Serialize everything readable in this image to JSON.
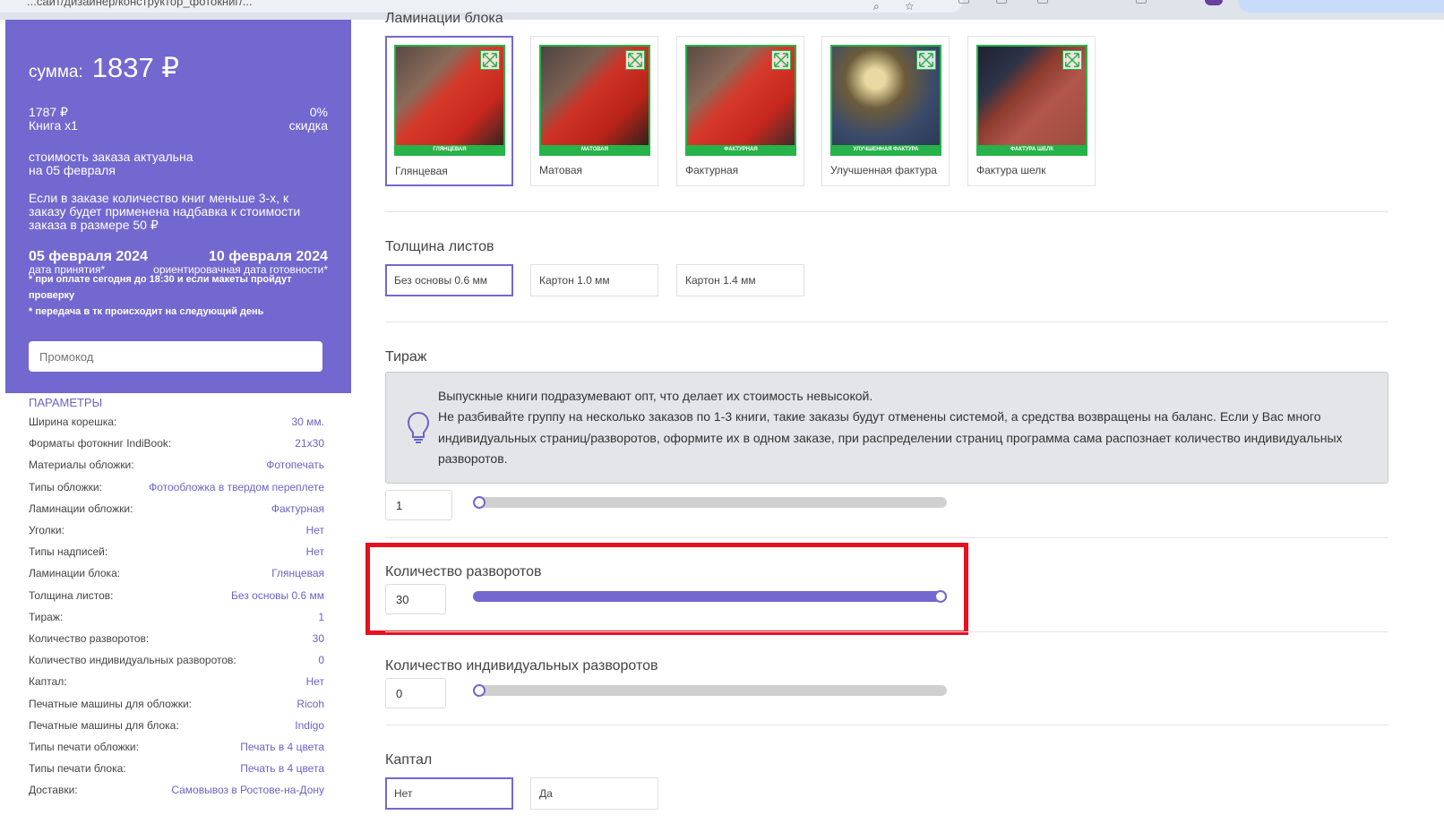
{
  "browser": {
    "url": "...сайт/дизайнер/конструктор_фотокниг/..."
  },
  "summary": {
    "sum_label": "сумма:",
    "sum_value": "1837 ₽",
    "price": "1787 ₽",
    "qty": "Книга x1",
    "discount_pct": "0%",
    "discount_label": "скидка",
    "actual_line1": "стоимость заказа актуальна",
    "actual_line2": "на 05 февраля",
    "notice": "Если в заказе количество книг меньше 3-х, к заказу будет применена надбавка к стоимости заказа в размере 50 ₽",
    "date_accept": "05 февраля 2024",
    "date_accept_label": "дата принятия*",
    "date_ready": "10 февраля 2024",
    "date_ready_label": "ориентировачная дата готовности*",
    "note1": "* при оплате сегодня до 18:30 и если макеты пройдут проверку",
    "note2": "* передача в тк происходит на следующий день",
    "promo_placeholder": "Промокод"
  },
  "params": {
    "title": "ПАРАМЕТРЫ",
    "rows": [
      {
        "k": "Ширина корешка:",
        "v": "30 мм."
      },
      {
        "k": "Форматы фотокниг IndiBook:",
        "v": "21x30"
      },
      {
        "k": "Материалы обложки:",
        "v": "Фотопечать"
      },
      {
        "k": "Типы обложки:",
        "v": "Фотообложка в твердом переплете"
      },
      {
        "k": "Ламинации обложки:",
        "v": "Фактурная"
      },
      {
        "k": "Уголки:",
        "v": "Нет"
      },
      {
        "k": "Типы надписей:",
        "v": "Нет"
      },
      {
        "k": "Ламинации блока:",
        "v": "Глянцевая"
      },
      {
        "k": "Толщина листов:",
        "v": "Без основы 0.6 мм"
      },
      {
        "k": "Тираж:",
        "v": "1"
      },
      {
        "k": "Количество разворотов:",
        "v": "30"
      },
      {
        "k": "Количество индивидуальных разворотов:",
        "v": "0"
      },
      {
        "k": "Каптал:",
        "v": "Нет"
      },
      {
        "k": "Печатные машины для обложки:",
        "v": "Ricoh"
      },
      {
        "k": "Печатные машины для блока:",
        "v": "Indigo"
      },
      {
        "k": "Типы печати обложки:",
        "v": "Печать в 4 цвета"
      },
      {
        "k": "Типы печати блока:",
        "v": "Печать в 4 цвета"
      },
      {
        "k": "Доставки:",
        "v": "Самовывоз в Ростове-на-Дону"
      }
    ]
  },
  "lamination": {
    "title": "Ламинации блока",
    "options": [
      {
        "label": "Глянцевая",
        "band": "ГЛЯНЦЕВАЯ",
        "selected": true
      },
      {
        "label": "Матовая",
        "band": "МАТОВАЯ",
        "selected": false
      },
      {
        "label": "Фактурная",
        "band": "ФАКТУРНАЯ",
        "selected": false
      },
      {
        "label": "Улучшенная фактура",
        "band": "УЛУЧШЕННАЯ ФАКТУРА",
        "selected": false
      },
      {
        "label": "Фактура шелк",
        "band": "ФАКТУРА ШЕЛК",
        "selected": false
      }
    ]
  },
  "thickness": {
    "title": "Толщина листов",
    "options": [
      "Без основы 0.6 мм",
      "Картон 1.0 мм",
      "Картон 1.4 мм"
    ]
  },
  "tirage": {
    "title": "Тираж",
    "info_line1": "Выпускные книги подразумевают опт, что делает их стоимость невысокой.",
    "info_line2": "Не разбивайте группу на несколько заказов по 1-3 книги, такие заказы будут отменены системой, а средства возвращены на баланс. Если у Вас много индивидуальных страниц/разворотов, оформите их в одном заказе, при распределении страниц программа сама распознает количество индивидуальных разворотов.",
    "value": "1",
    "slider_fraction": 0
  },
  "spreads": {
    "title": "Количество разворотов",
    "value": "30",
    "slider_fraction": 1
  },
  "individual": {
    "title": "Количество индивидуальных разворотов",
    "value": "0",
    "slider_fraction": 0
  },
  "kaptal": {
    "title": "Каптал",
    "options": [
      "Нет",
      "Да"
    ]
  },
  "colors": {
    "accent": "#7268cf",
    "green": "#26b34a",
    "highlight": "#e8101f"
  }
}
